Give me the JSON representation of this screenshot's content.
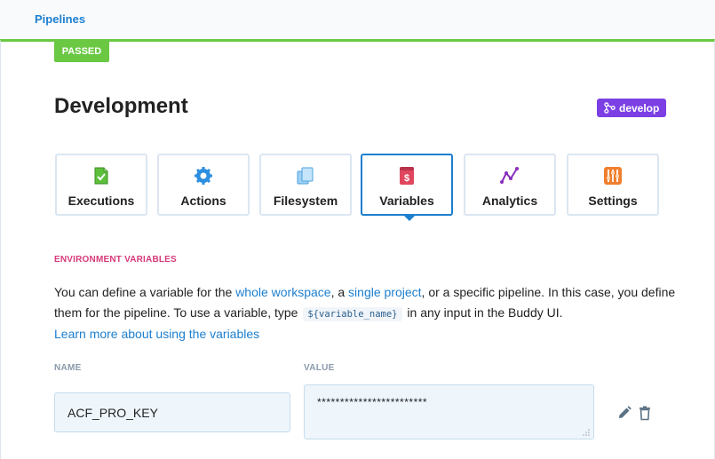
{
  "breadcrumb": {
    "label": "Pipelines"
  },
  "pipeline": {
    "status": "PASSED",
    "title": "Development",
    "branch": "develop"
  },
  "tabs": [
    {
      "label": "Executions",
      "icon": "executions-icon"
    },
    {
      "label": "Actions",
      "icon": "gear-icon"
    },
    {
      "label": "Filesystem",
      "icon": "files-icon"
    },
    {
      "label": "Variables",
      "icon": "dollar-icon",
      "active": true
    },
    {
      "label": "Analytics",
      "icon": "chart-icon"
    },
    {
      "label": "Settings",
      "icon": "sliders-icon"
    }
  ],
  "env": {
    "section_label": "ENVIRONMENT VARIABLES",
    "desc_part1": "You can define a variable for the ",
    "link_workspace": "whole workspace",
    "desc_part2": ", a ",
    "link_project": "single project",
    "desc_part3": ", or a specific pipeline. In this case, you define them for the pipeline. To use a variable, type ",
    "code": "${variable_name}",
    "desc_part4": " in any input in the Buddy UI.",
    "learn_more": "Learn more about using the variables"
  },
  "table": {
    "col_name": "NAME",
    "col_value": "VALUE",
    "rows": [
      {
        "name": "ACF_PRO_KEY",
        "value": "************************"
      }
    ]
  },
  "colors": {
    "accent": "#1d7fcf",
    "passed": "#6bc843",
    "branch": "#7b3fe4",
    "section": "#d63b7a"
  }
}
